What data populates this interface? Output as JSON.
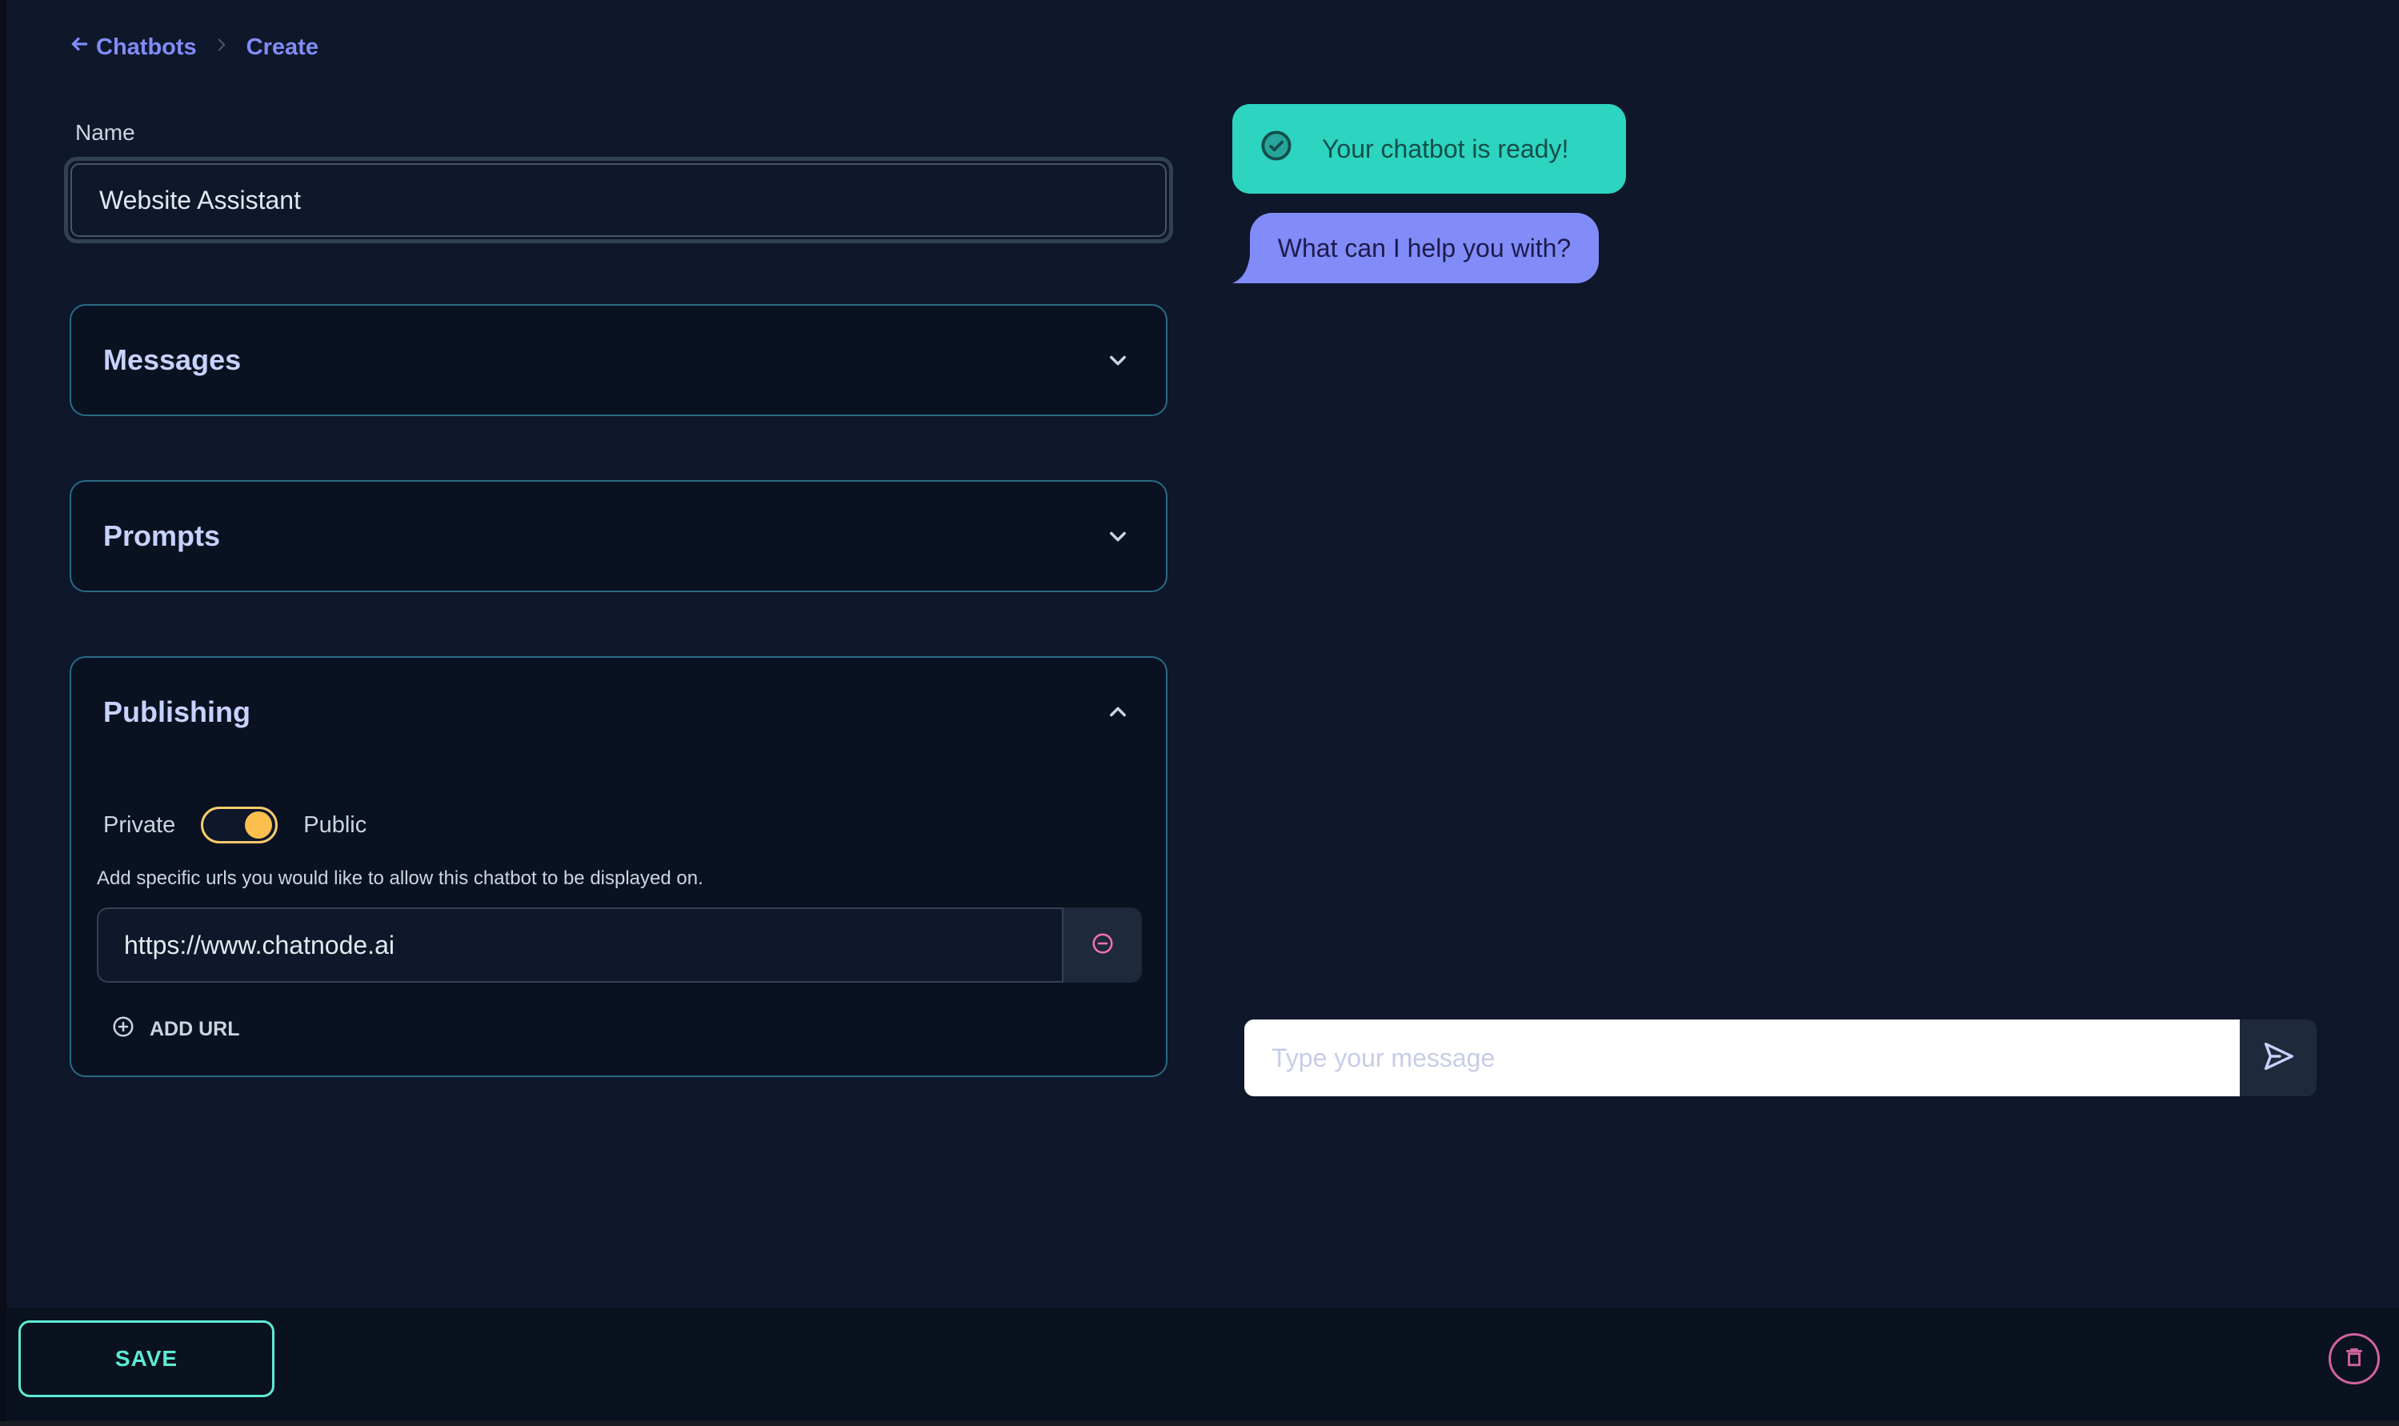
{
  "breadcrumb": {
    "back_icon": "arrow-left-icon",
    "parent": "Chatbots",
    "separator_icon": "chevron-right-icon",
    "current": "Create"
  },
  "name_field": {
    "label": "Name",
    "value": "Website Assistant"
  },
  "sections": {
    "messages": {
      "title": "Messages",
      "expanded": false,
      "icon": "chevron-down-icon"
    },
    "prompts": {
      "title": "Prompts",
      "expanded": false,
      "icon": "chevron-down-icon"
    },
    "publishing": {
      "title": "Publishing",
      "expanded": true,
      "icon": "chevron-up-icon",
      "toggle_left_label": "Private",
      "toggle_right_label": "Public",
      "toggle_state": "Public",
      "help_text": "Add specific urls you would like to allow this chatbot to be displayed on.",
      "urls": [
        "https://www.chatnode.ai"
      ],
      "remove_icon": "minus-circle-icon",
      "add_url_label": "ADD URL",
      "add_url_icon": "plus-circle-icon"
    }
  },
  "chat_preview": {
    "status_message": "Your chatbot is ready!",
    "status_icon": "check-circle-icon",
    "bot_message": "What can I help you with?",
    "input_placeholder": "Type your message",
    "send_icon": "send-icon"
  },
  "footer": {
    "save_label": "SAVE",
    "delete_icon": "trash-icon"
  },
  "colors": {
    "accent_indigo": "#818cf8",
    "accent_teal": "#2dd4bf",
    "save_teal": "#5eead4",
    "toggle_amber": "#fbbf4d",
    "danger_pink": "#f472b6",
    "panel_border": "#2b6a86"
  }
}
